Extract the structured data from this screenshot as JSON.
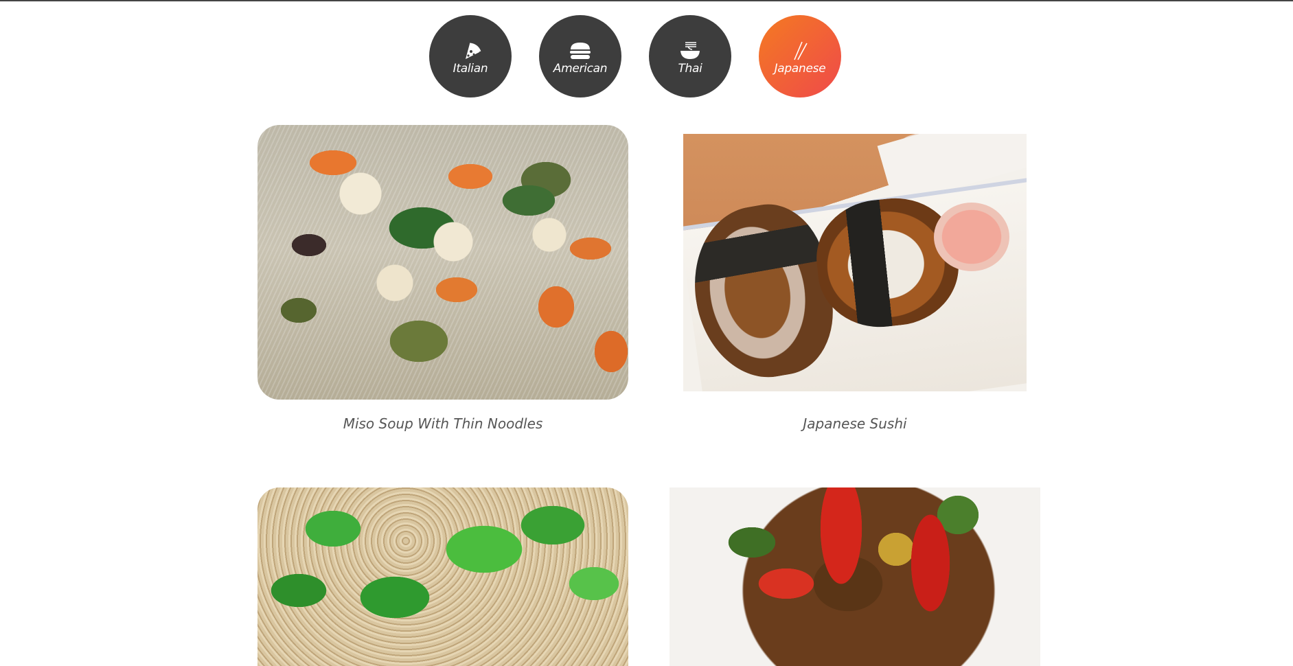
{
  "categories": [
    {
      "id": "italian",
      "label": "Italian",
      "icon": "pizza-slice-icon",
      "active": false
    },
    {
      "id": "american",
      "label": "American",
      "icon": "burger-icon",
      "active": false
    },
    {
      "id": "thai",
      "label": "Thai",
      "icon": "noodle-bowl-icon",
      "active": false
    },
    {
      "id": "japanese",
      "label": "Japanese",
      "icon": "chopsticks-icon",
      "active": true
    }
  ],
  "colors": {
    "inactive_circle": "#3d3d3d",
    "active_gradient_start": "#f47a22",
    "active_gradient_end": "#ef4a4a",
    "caption_text": "#555555"
  },
  "dishes": [
    {
      "name": "Miso Soup With Thin Noodles"
    },
    {
      "name": "Japanese Sushi"
    },
    {
      "name": ""
    },
    {
      "name": ""
    }
  ]
}
